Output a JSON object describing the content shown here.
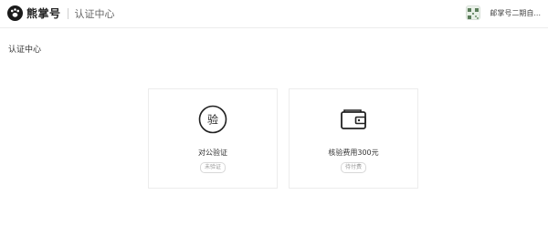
{
  "header": {
    "logo_text": "熊掌号",
    "section": "认证中心",
    "user_name": "邮掌号二期自..."
  },
  "page": {
    "title": "认证中心"
  },
  "cards": [
    {
      "icon": "verify-seal-icon",
      "icon_char": "验",
      "label": "对公验证",
      "status": "未验证"
    },
    {
      "icon": "wallet-icon",
      "label": "核验费用300元",
      "status": "待付费"
    }
  ]
}
